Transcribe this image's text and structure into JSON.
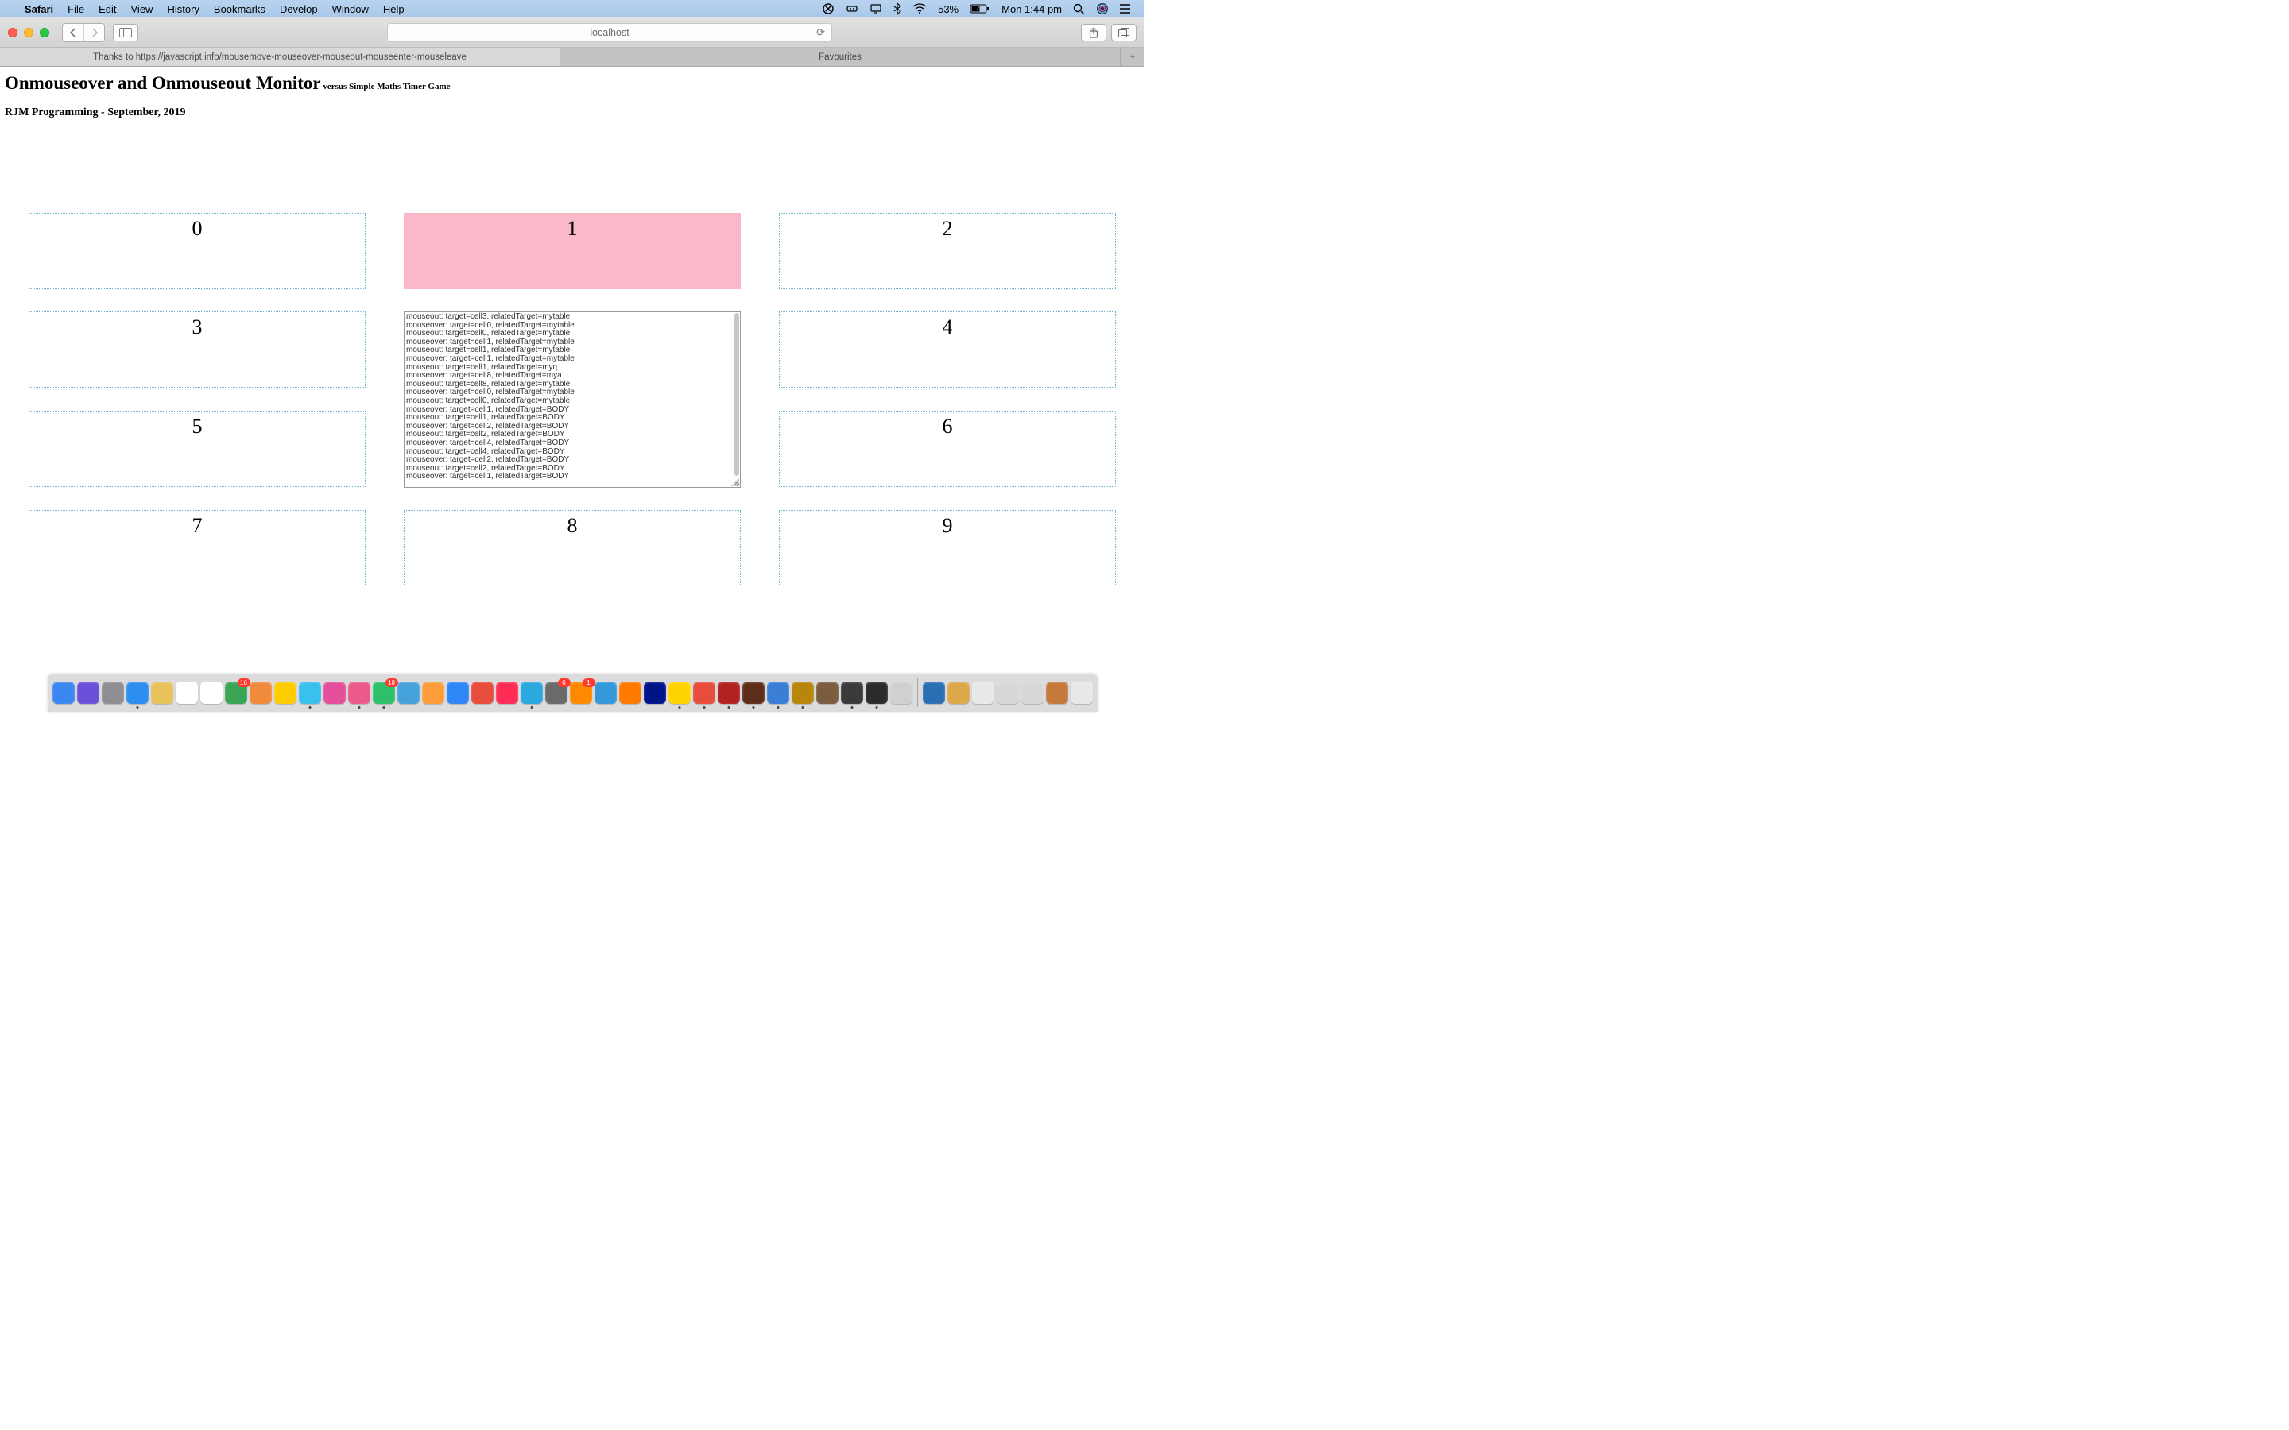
{
  "menubar": {
    "apple": "",
    "app": "Safari",
    "items": [
      "File",
      "Edit",
      "View",
      "History",
      "Bookmarks",
      "Develop",
      "Window",
      "Help"
    ],
    "battery": "53%",
    "clock": "Mon 1:44 pm"
  },
  "toolbar": {
    "url": "localhost"
  },
  "tabs": {
    "active": "Thanks to https://javascript.info/mousemove-mouseover-mouseout-mouseenter-mouseleave",
    "inactive": "Favourites"
  },
  "page": {
    "title": "Onmouseover and Onmouseout Monitor",
    "subtitle": " versus Simple Maths Timer Game",
    "byline": "RJM Programming - September, 2019"
  },
  "cells": {
    "c0": "0",
    "c1": "1",
    "c2": "2",
    "c3": "3",
    "c4": "4",
    "c5": "5",
    "c6": "6",
    "c7": "7",
    "c8": "8",
    "c9": "9"
  },
  "log": [
    "mouseout:  target=cell3,  relatedTarget=mytable",
    "mouseover: target=cell0,  relatedTarget=mytable",
    "mouseout:  target=cell0,  relatedTarget=mytable",
    "mouseover: target=cell1,  relatedTarget=mytable",
    "mouseout:  target=cell1,  relatedTarget=mytable",
    "mouseover: target=cell1,  relatedTarget=mytable",
    "mouseout:  target=cell1,  relatedTarget=myq",
    "mouseover: target=cell8,  relatedTarget=mya",
    "mouseout:  target=cell8,  relatedTarget=mytable",
    "mouseover: target=cell0,  relatedTarget=mytable",
    "mouseout:  target=cell0,  relatedTarget=mytable",
    "mouseover: target=cell1,  relatedTarget=BODY",
    "mouseout:  target=cell1,  relatedTarget=BODY",
    "mouseover: target=cell2,  relatedTarget=BODY",
    "mouseout:  target=cell2,  relatedTarget=BODY",
    "mouseover: target=cell4,  relatedTarget=BODY",
    "mouseout:  target=cell4,  relatedTarget=BODY",
    "mouseover: target=cell2,  relatedTarget=BODY",
    "mouseout:  target=cell2,  relatedTarget=BODY",
    "mouseover: target=cell1,  relatedTarget=BODY"
  ],
  "dock_colors": [
    "#3b87f0",
    "#6b4fd8",
    "#8e8e93",
    "#2b8ef0",
    "#e8c25a",
    "#fff",
    "#fff",
    "#3aa655",
    "#f08b3b",
    "#ffcc00",
    "#39c0ed",
    "#e34f9a",
    "#ec5a8a",
    "#2ec16a",
    "#46a2da",
    "#ff9d3b",
    "#2f86f5",
    "#e74c3c",
    "#ff2d55",
    "#2aa8e0",
    "#6a6a6a",
    "#ff8a00",
    "#3498db",
    "#ff7a00",
    "#001489",
    "#ffd400",
    "#e74c3c",
    "#b22222",
    "#5d2f1a",
    "#3a7fd5",
    "#b8860b",
    "#7b5c3e",
    "#3a3a3a",
    "#2b2b2b",
    "#d0d0d0"
  ],
  "dock_right": [
    "#2b6fb3",
    "#dca84a",
    "#e8e8e8",
    "#d7d7d7",
    "#d7d7d7",
    "#c47a3d",
    "#e8e8e8"
  ]
}
